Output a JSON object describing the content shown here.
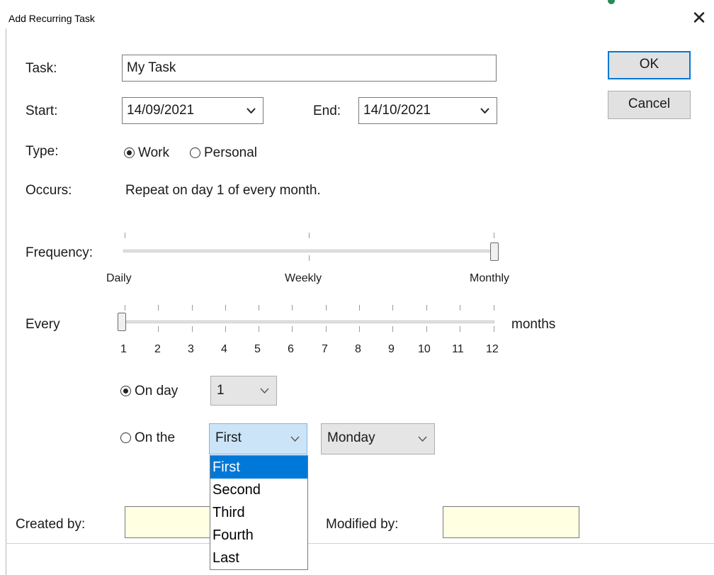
{
  "window": {
    "title": "Add Recurring Task",
    "close_glyph": "✕",
    "close_icon": "close-icon"
  },
  "form": {
    "task_label": "Task:",
    "task_value": "My Task",
    "start_label": "Start:",
    "start_value": "14/09/2021",
    "end_label": "End:",
    "end_value": "14/10/2021",
    "type_label": "Type:",
    "type_options": [
      "Work",
      "Personal"
    ],
    "type_selected": "Work",
    "occurs_label": "Occurs:",
    "occurs_text": "Repeat on day 1 of every month."
  },
  "buttons": {
    "ok": "OK",
    "cancel": "Cancel"
  },
  "frequency": {
    "label": "Frequency:",
    "stops": [
      "Daily",
      "Weekly",
      "Monthly"
    ],
    "selected": "Monthly"
  },
  "every": {
    "label": "Every",
    "unit": "months",
    "ticks": [
      "1",
      "2",
      "3",
      "4",
      "5",
      "6",
      "7",
      "8",
      "9",
      "10",
      "11",
      "12"
    ],
    "value": 1
  },
  "on_day": {
    "label": "On day",
    "selected": true,
    "value": "1"
  },
  "on_the": {
    "label": "On the",
    "selected": false,
    "ordinal_value": "First",
    "ordinal_options": [
      "First",
      "Second",
      "Third",
      "Fourth",
      "Last"
    ],
    "weekday_value": "Monday"
  },
  "footer": {
    "created_by_label": "Created by:",
    "modified_by_label": "Modified by:"
  },
  "colors": {
    "accent": "#0078d7",
    "readonly_bg": "#ffffe1",
    "open_combo_bg": "#cce4f7"
  }
}
